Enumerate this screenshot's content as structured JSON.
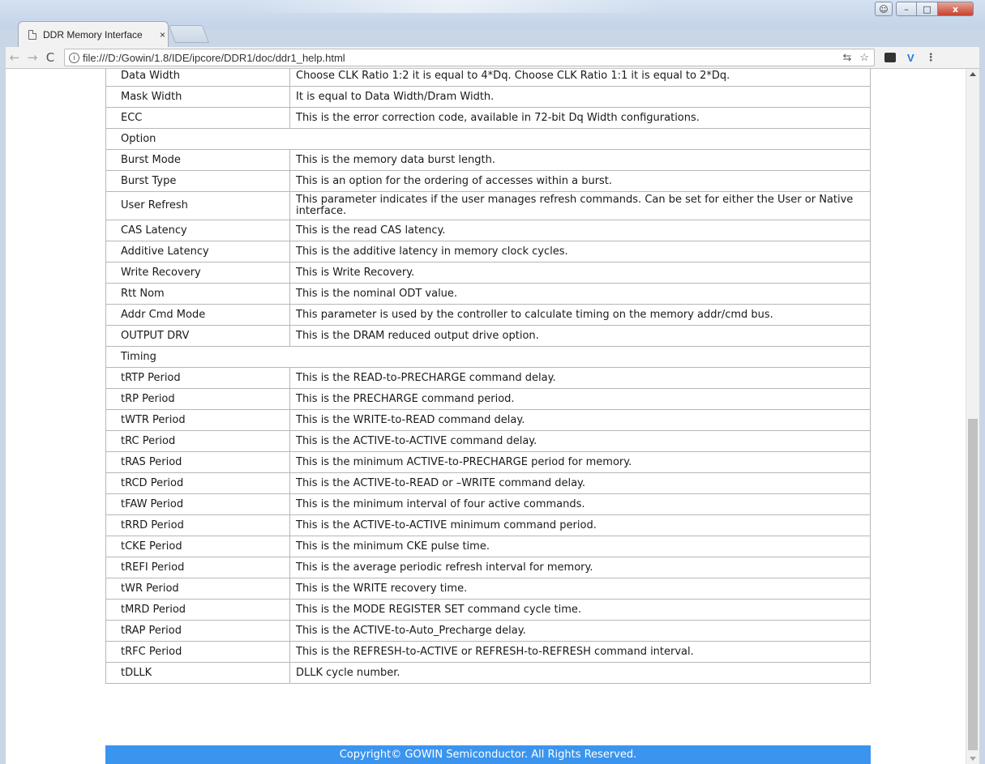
{
  "browser": {
    "tab_title": "DDR Memory Interface",
    "tab_close": "×",
    "url": "file:///D:/Gowin/1.8/IDE/ipcore/DDR1/doc/ddr1_help.html",
    "nav": {
      "back": "←",
      "forward": "→",
      "reload": "C"
    },
    "omnibox_icons": [
      "translate-icon",
      "star-icon"
    ],
    "extensions": [
      "ext-dark-icon",
      "ext-v-icon",
      "menu-icon"
    ],
    "window_controls": {
      "minimize": "–",
      "maximize": "□",
      "close": "x"
    }
  },
  "table": {
    "rows": [
      {
        "name": "Data Width",
        "desc": "Choose CLK Ratio 1:2 it is equal to 4*Dq. Choose CLK Ratio 1:1 it is equal to 2*Dq."
      },
      {
        "name": "Mask Width",
        "desc": "It is equal to Data Width/Dram Width."
      },
      {
        "name": "ECC",
        "desc": "This is the error correction code, available in 72-bit Dq Width configurations."
      },
      {
        "section": "Option"
      },
      {
        "name": "Burst Mode",
        "desc": "This is the memory data burst length."
      },
      {
        "name": "Burst Type",
        "desc": "This is an option for the ordering of accesses within a burst."
      },
      {
        "name": "User Refresh",
        "desc": "This parameter indicates if the user manages refresh commands. Can be set for either the User or Native interface."
      },
      {
        "name": "CAS Latency",
        "desc": "This is the read CAS latency."
      },
      {
        "name": "Additive Latency",
        "desc": "This is the additive latency in memory clock cycles."
      },
      {
        "name": "Write Recovery",
        "desc": "This is Write Recovery."
      },
      {
        "name": "Rtt Nom",
        "desc": "This is the nominal ODT value."
      },
      {
        "name": "Addr Cmd Mode",
        "desc": "This parameter is used by the controller to calculate timing on the memory addr/cmd bus."
      },
      {
        "name": "OUTPUT DRV",
        "desc": "This is the DRAM reduced output drive option."
      },
      {
        "section": "Timing"
      },
      {
        "name": "tRTP Period",
        "desc": "This is the READ-to-PRECHARGE command delay."
      },
      {
        "name": "tRP Period",
        "desc": "This is the PRECHARGE command period."
      },
      {
        "name": "tWTR Period",
        "desc": "This is the WRITE-to-READ command delay."
      },
      {
        "name": "tRC Period",
        "desc": "This is the ACTIVE-to-ACTIVE command delay."
      },
      {
        "name": "tRAS Period",
        "desc": "This is the minimum ACTIVE-to-PRECHARGE period for memory."
      },
      {
        "name": "tRCD Period",
        "desc": "This is the ACTIVE-to-READ or –WRITE command delay."
      },
      {
        "name": "tFAW Period",
        "desc": "This is the minimum interval of four active commands."
      },
      {
        "name": "tRRD Period",
        "desc": "This is the ACTIVE-to-ACTIVE minimum command period."
      },
      {
        "name": "tCKE Period",
        "desc": "This is the minimum CKE pulse time."
      },
      {
        "name": "tREFI Period",
        "desc": "This is the average periodic refresh interval for memory."
      },
      {
        "name": "tWR Period",
        "desc": "This is the WRITE recovery time."
      },
      {
        "name": "tMRD Period",
        "desc": "This is the MODE REGISTER SET command cycle time."
      },
      {
        "name": "tRAP Period",
        "desc": "This is the ACTIVE-to-Auto_Precharge delay."
      },
      {
        "name": "tRFC Period",
        "desc": "This is the REFRESH-to-ACTIVE or REFRESH-to-REFRESH command interval."
      },
      {
        "name": "tDLLK",
        "desc": "DLLK cycle number."
      }
    ]
  },
  "footer": {
    "text": "Copyright© GOWIN Semiconductor. All Rights Reserved."
  },
  "colors": {
    "footer_bg": "#3b95ef",
    "table_border": "#b7b7b7"
  }
}
